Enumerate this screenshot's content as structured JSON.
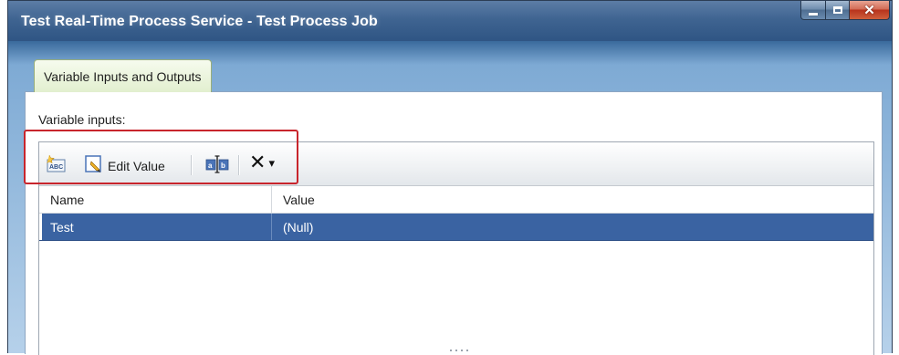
{
  "window": {
    "title": "Test Real-Time Process Service - Test Process Job",
    "controls": {
      "minimize": "minimize",
      "maximize": "maximize",
      "close": "✕"
    }
  },
  "tabs": [
    {
      "label": "Variable Inputs and Outputs",
      "selected": true
    }
  ],
  "variable_inputs": {
    "label": "Variable inputs:",
    "toolbar": {
      "add_icon": "add-variable-icon",
      "edit_value_icon": "edit-value-icon",
      "edit_value_label": "Edit Value",
      "rename_icon": "rename-icon",
      "delete_icon": "delete-icon",
      "delete_glyph": "✕",
      "dropdown_glyph": "▾"
    },
    "table": {
      "columns": [
        "Name",
        "Value"
      ],
      "rows": [
        {
          "name": "Test",
          "value": "(Null)",
          "selected": true
        }
      ]
    }
  },
  "colors": {
    "selection": "#3a63a2",
    "highlight_box": "#c8252c",
    "tab_background": "#e2efcf"
  }
}
